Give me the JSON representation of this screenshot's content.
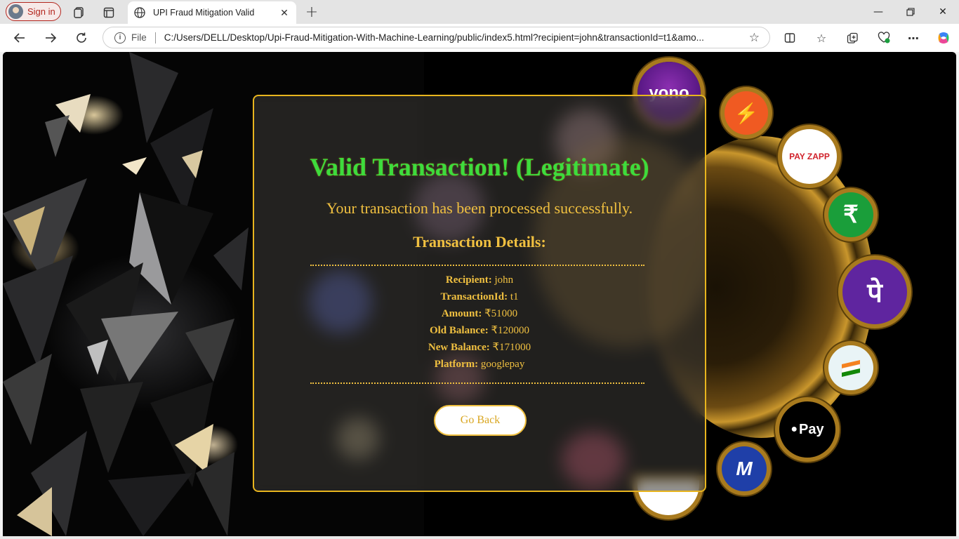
{
  "browser": {
    "signin_label": "Sign in",
    "tab_title": "UPI Fraud Mitigation Valid",
    "url_scheme_label": "File",
    "url": "C:/Users/DELL/Desktop/Upi-Fraud-Mitigation-With-Machine-Learning/public/index5.html?recipient=john&transactionId=t1&amo..."
  },
  "card": {
    "title": "Valid Transaction! (Legitimate)",
    "subtitle": "Your transaction has been processed successfully.",
    "details_heading": "Transaction Details:",
    "details": [
      {
        "label": "Recipient:",
        "value": "john"
      },
      {
        "label": "TransactionId:",
        "value": "t1"
      },
      {
        "label": "Amount:",
        "value": "₹51000"
      },
      {
        "label": "Old Balance:",
        "value": "₹120000"
      },
      {
        "label": "New Balance:",
        "value": "₹171000"
      },
      {
        "label": "Platform:",
        "value": "googlepay"
      }
    ],
    "go_back_label": "Go Back"
  },
  "background_logos": {
    "yono": "yono",
    "payzapp": "PAY ZAPP",
    "rupee": "₹",
    "phonepe": "पे",
    "applepay": "Pay",
    "mobikwik": "M"
  },
  "colors": {
    "title_green": "#3ddc3d",
    "gold": "#f0c040",
    "card_border": "#e8b51e"
  }
}
